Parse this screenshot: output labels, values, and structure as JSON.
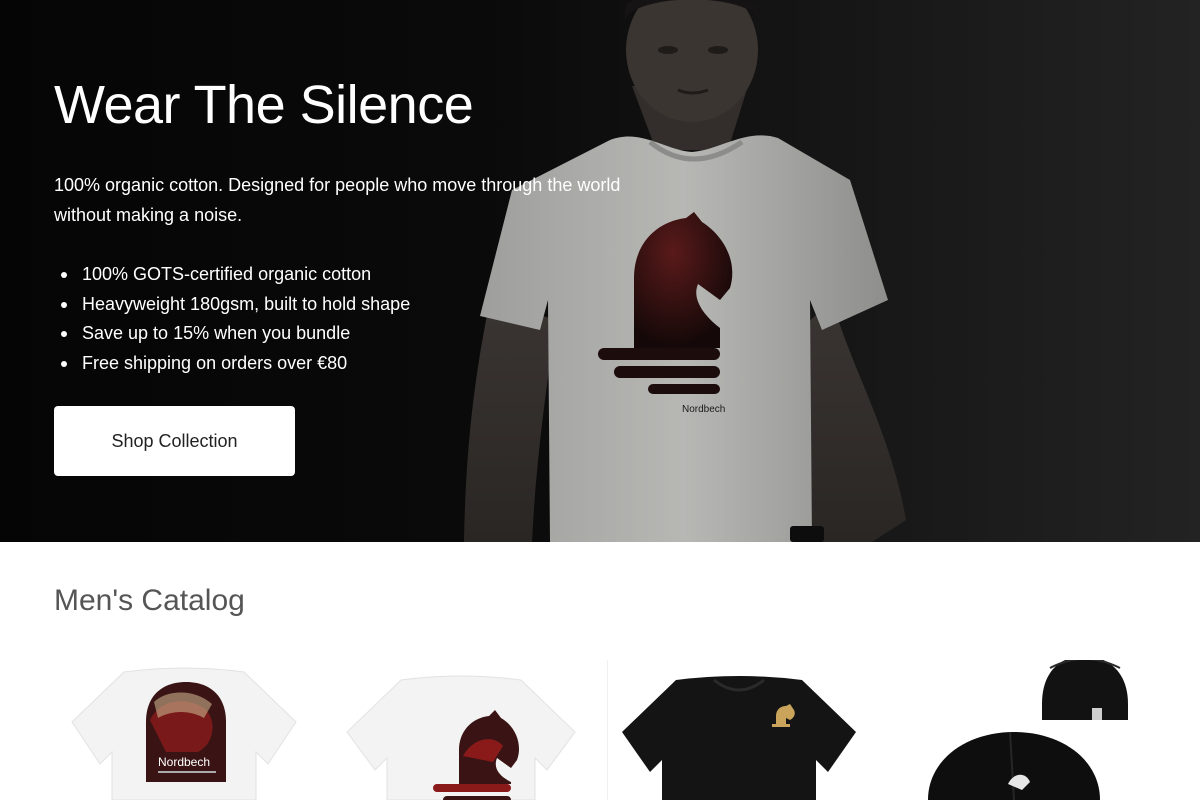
{
  "hero": {
    "title": "Wear The Silence",
    "description": "100% organic cotton. Designed for people who move through the world without making a noise.",
    "features": [
      "100% GOTS-certified organic cotton",
      "Heavyweight 180gsm, built to hold shape",
      "Save up to 15% when you bundle",
      "Free shipping on orders over €80"
    ],
    "cta_label": "Shop Collection",
    "shirt_brand": "Nordbech"
  },
  "catalog": {
    "title": "Men's Catalog",
    "products": [
      {
        "image": "white-tshirt-back-print",
        "brand": "Nordbech"
      },
      {
        "image": "white-tshirt-horse-logo"
      },
      {
        "image": "black-tshirt-small-logo"
      },
      {
        "image": "black-cap"
      }
    ]
  },
  "colors": {
    "hero_bg": "#0a0a0a",
    "accent_red": "#8a1a1a",
    "button_bg": "#ffffff",
    "catalog_title": "#555555"
  }
}
